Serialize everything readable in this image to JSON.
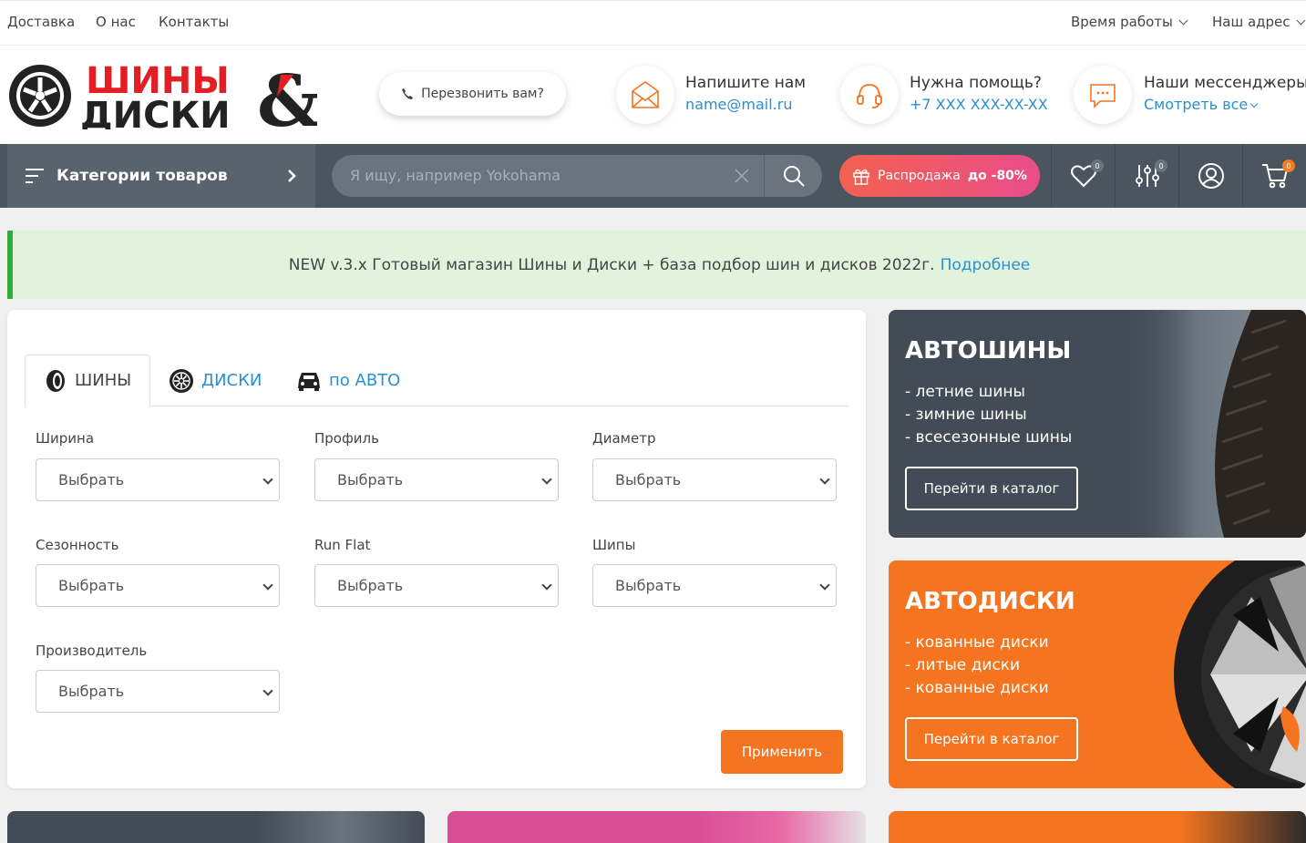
{
  "topbar": {
    "links": [
      "Доставка",
      "О нас",
      "Контакты"
    ],
    "hours": "Время работы",
    "address": "Наш адрес"
  },
  "header": {
    "logo_line1": "ШИНЫ",
    "logo_line2": "ДИСКИ",
    "callback": "Перезвонить вам?",
    "contacts": [
      {
        "title": "Напишите нам",
        "sub": "name@mail.ru",
        "icon": "envelope-icon"
      },
      {
        "title": "Нужна помощь?",
        "sub": "+7 XXX XXX-XX-XX",
        "icon": "headset-icon"
      },
      {
        "title": "Наши мессенджеры",
        "sub": "Смотреть все",
        "icon": "chat-icon"
      }
    ]
  },
  "nav": {
    "categories": "Категории товаров",
    "search_placeholder": "Я ищу, например Yokohama",
    "sale_text": "Распродажа",
    "sale_bold": "до -80%",
    "wishlist_count": "0",
    "compare_count": "0",
    "cart_count": "0"
  },
  "notice": {
    "text": "NEW v.3.x Готовый магазин Шины и Диски + база подбор шин и дисков 2022г.",
    "link": "Подробнее"
  },
  "filter": {
    "tabs": [
      "ШИНЫ",
      "ДИСКИ",
      "по АВТО"
    ],
    "fields": [
      {
        "label": "Ширина",
        "value": "Выбрать"
      },
      {
        "label": "Профиль",
        "value": "Выбрать"
      },
      {
        "label": "Диаметр",
        "value": "Выбрать"
      },
      {
        "label": "Сезонность",
        "value": "Выбрать"
      },
      {
        "label": "Run Flat",
        "value": "Выбрать"
      },
      {
        "label": "Шипы",
        "value": "Выбрать"
      },
      {
        "label": "Производитель",
        "value": "Выбрать"
      }
    ],
    "apply": "Применить"
  },
  "promos": [
    {
      "title": "АВТОШИНЫ",
      "items": [
        "- летние шины",
        "- зимние шины",
        "- всесезонные шины"
      ],
      "button": "Перейти в каталог",
      "color": "#434c56"
    },
    {
      "title": "АВТОДИСКИ",
      "items": [
        "- кованные диски",
        "- литые диски",
        "- кованные диски"
      ],
      "button": "Перейти в каталог",
      "color": "#f4741f"
    }
  ],
  "colors": {
    "accent": "#f4741f",
    "link": "#2a8fd0",
    "nav": "#4b5560",
    "brand_red": "#e31e24"
  }
}
